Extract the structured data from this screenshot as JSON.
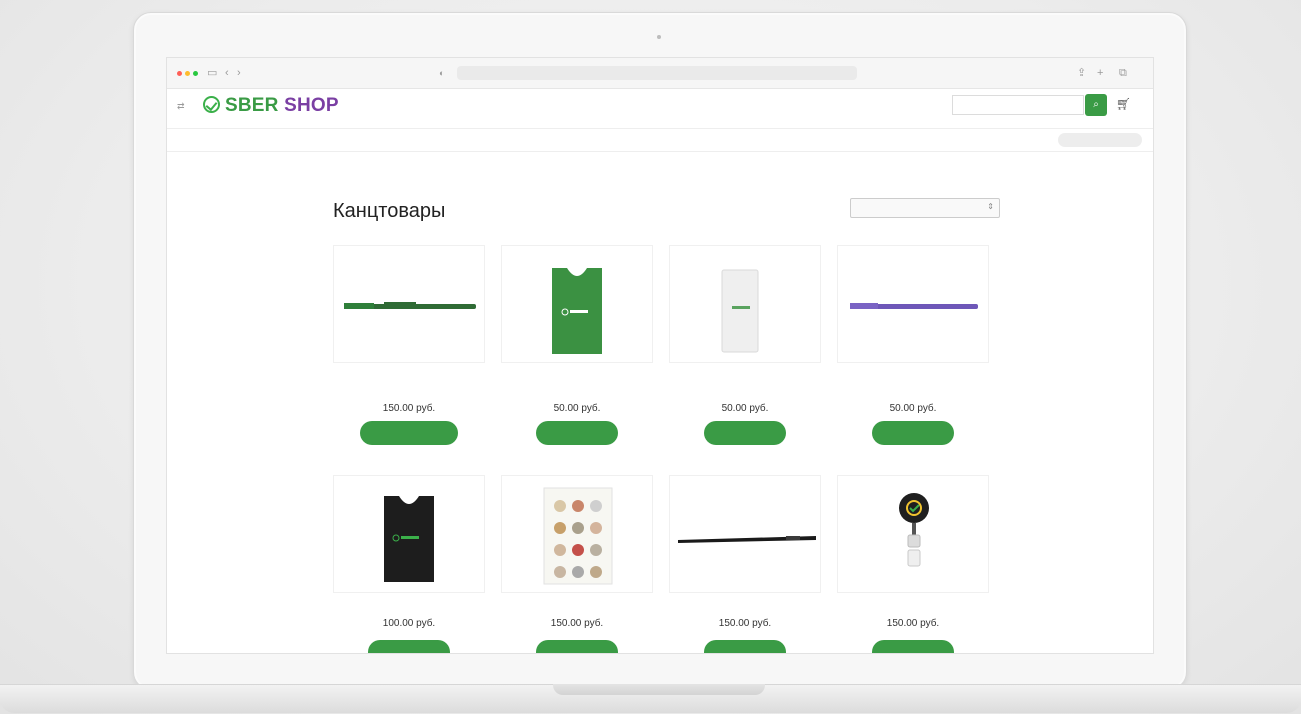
{
  "browser": {
    "address": "",
    "back_glyph": "‹",
    "forward_glyph": "›"
  },
  "header": {
    "logo_sber": "SBER",
    "logo_shop": "SHOP",
    "links": [
      "",
      ""
    ],
    "login": "",
    "search_placeholder": "",
    "search_icon": "search-icon",
    "cart_icon": "cart-icon"
  },
  "category_nav": {
    "items": [
      "",
      "",
      "",
      "",
      "",
      "",
      ""
    ],
    "callback_button": ""
  },
  "breadcrumb": "",
  "page": {
    "title": "Канцтовары",
    "count": ""
  },
  "sort": {
    "label": "",
    "selected": ""
  },
  "products": [
    {
      "name": "",
      "price": "150.00 руб.",
      "button": ""
    },
    {
      "name": "",
      "price": "50.00 руб.",
      "button": ""
    },
    {
      "name": "",
      "price": "50.00 руб.",
      "button": ""
    },
    {
      "name": "",
      "price": "50.00 руб.",
      "button": ""
    },
    {
      "name": "",
      "price": "100.00 руб.",
      "button": ""
    },
    {
      "name": "",
      "price": "150.00 руб.",
      "button": ""
    },
    {
      "name": "",
      "price": "150.00 руб.",
      "button": ""
    },
    {
      "name": "",
      "price": "150.00 руб.",
      "button": ""
    }
  ],
  "colors": {
    "brand_green": "#3a9b45",
    "brand_purple": "#7a3fa3"
  }
}
